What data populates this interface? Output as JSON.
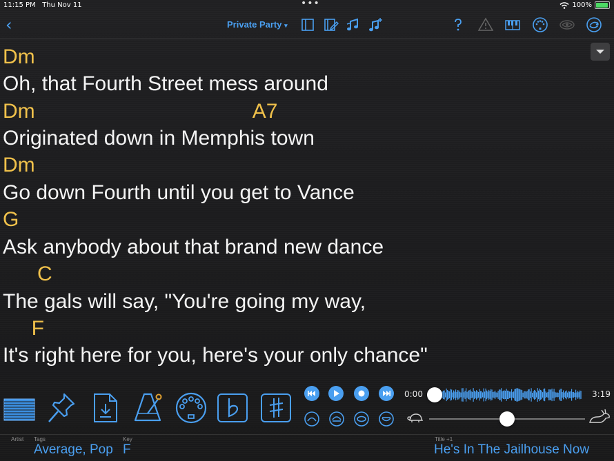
{
  "status": {
    "time": "11:15 PM",
    "date": "Thu Nov 11",
    "battery": "100%"
  },
  "nav": {
    "set_name": "Private Party",
    "set_caret": "▾"
  },
  "lyrics": [
    {
      "chord": "Dm",
      "line": "Oh, that Fourth Street mess around"
    },
    {
      "chord": "Dm                                      A7",
      "line": "Originated down in Memphis town"
    },
    {
      "chord": "Dm",
      "line": "Go down Fourth until you get to Vance"
    },
    {
      "chord": "G",
      "line": "Ask anybody about that brand new dance"
    },
    {
      "chord": "      C",
      "line": "The gals will say, \"You're going my way,"
    },
    {
      "chord": "     F",
      "line": "It's right here for you, here's your only chance\""
    }
  ],
  "player": {
    "elapsed": "0:00",
    "duration": "3:19",
    "position": 0.0,
    "speed": 0.5
  },
  "footer": {
    "artist_label": "Artist",
    "tags_label": "Tags",
    "tags_value": "Average, Pop",
    "key_label": "Key",
    "key_value": "F",
    "title_label": "Title +1",
    "title_value": "He's In The Jailhouse Now"
  },
  "colors": {
    "accent": "#4a9ff0",
    "chord": "#f0c14b",
    "background": "#1c1c1e"
  }
}
